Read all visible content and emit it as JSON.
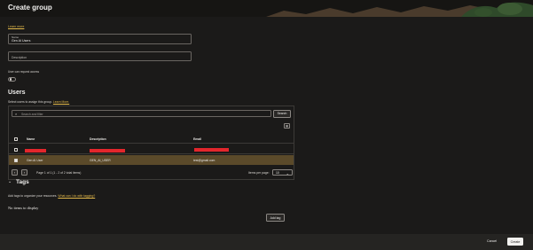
{
  "header": {
    "title": "Create group"
  },
  "learn_more": "Learn more",
  "name_field": {
    "label": "Name",
    "value": "Gen AI Users"
  },
  "description_field": {
    "placeholder": "Description"
  },
  "require_access": {
    "label": "User can request access"
  },
  "users": {
    "heading": "Users",
    "subtitle": "Select users to assign this group.",
    "subtitle_link": "Learn More.",
    "search_placeholder": "Search and filter",
    "search_button": "Search",
    "columns": [
      "Name",
      "Description",
      "Email"
    ],
    "rows": [
      {
        "name": "",
        "description": "",
        "email": "",
        "checked": false,
        "redacted": true
      },
      {
        "name": "Gen AI User",
        "description": "GEN_AI_USER",
        "email": "test@gmail.com",
        "checked": true,
        "redacted": false
      }
    ],
    "pagination": {
      "summary": "Page 1 of 1 (1 - 2 of 2 total items)",
      "items_per_page_label": "Items per page:",
      "items_per_page": "10"
    }
  },
  "tags": {
    "heading": "Tags",
    "subtitle": "Add tags to organize your resources.",
    "subtitle_link": "What can I do with tagging?",
    "empty": "No items to display",
    "add_button": "Add tag"
  },
  "footer": {
    "cancel": "Cancel",
    "create": "Create"
  },
  "colors": {
    "accent": "#e2b84a",
    "selected_row": "#5b4a2a",
    "redaction": "#e3262c"
  }
}
